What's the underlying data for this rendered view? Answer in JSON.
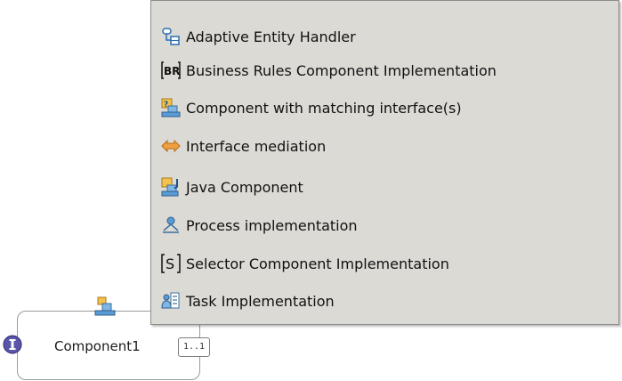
{
  "menu": {
    "items": [
      {
        "label": "Adaptive Entity Handler",
        "icon": "adaptive-entity-icon"
      },
      {
        "label": "Business Rules Component Implementation",
        "icon": "business-rules-icon"
      },
      {
        "label": "Component with matching interface(s)",
        "icon": "matching-interface-icon"
      },
      {
        "label": "Interface mediation",
        "icon": "interface-mediation-icon"
      },
      {
        "label": "Java Component",
        "icon": "java-component-icon"
      },
      {
        "label": "Process implementation",
        "icon": "process-icon"
      },
      {
        "label": "Selector Component Implementation",
        "icon": "selector-icon"
      },
      {
        "label": "Task Implementation",
        "icon": "task-icon"
      }
    ]
  },
  "component": {
    "label": "Component1",
    "multiplicity": "1..1"
  }
}
